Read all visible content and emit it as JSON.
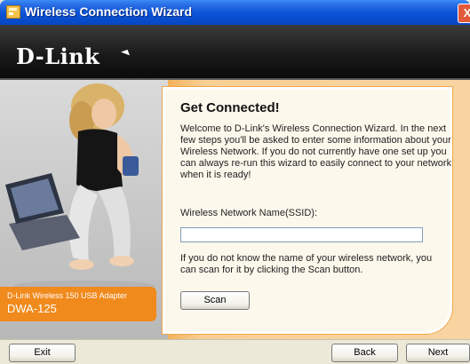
{
  "window": {
    "title": "Wireless Connection Wizard",
    "close_glyph": "X",
    "icon": "wizard-app-icon"
  },
  "header": {
    "logo_text": "D-Link"
  },
  "left_panel": {
    "product_line1": "D-Link Wireless 150 USB Adapter",
    "product_line2": "DWA-125",
    "accent_color": "#f08a1c"
  },
  "main": {
    "heading": "Get Connected!",
    "welcome_text": "Welcome to D-Link's Wireless Connection Wizard. In the next few steps you'll be asked to enter some information about your Wireless Network. If you do not currently have one set up you can always re-run this wizard to easily connect to your network when it is ready!",
    "ssid_label": "Wireless Network Name(SSID):",
    "ssid_value": "",
    "help_text": "If you do not know the name of your wireless network, you can scan for it by clicking the Scan button.",
    "scan_label": "Scan"
  },
  "footer": {
    "exit_label": "Exit",
    "back_label": "Back",
    "next_label": "Next"
  }
}
